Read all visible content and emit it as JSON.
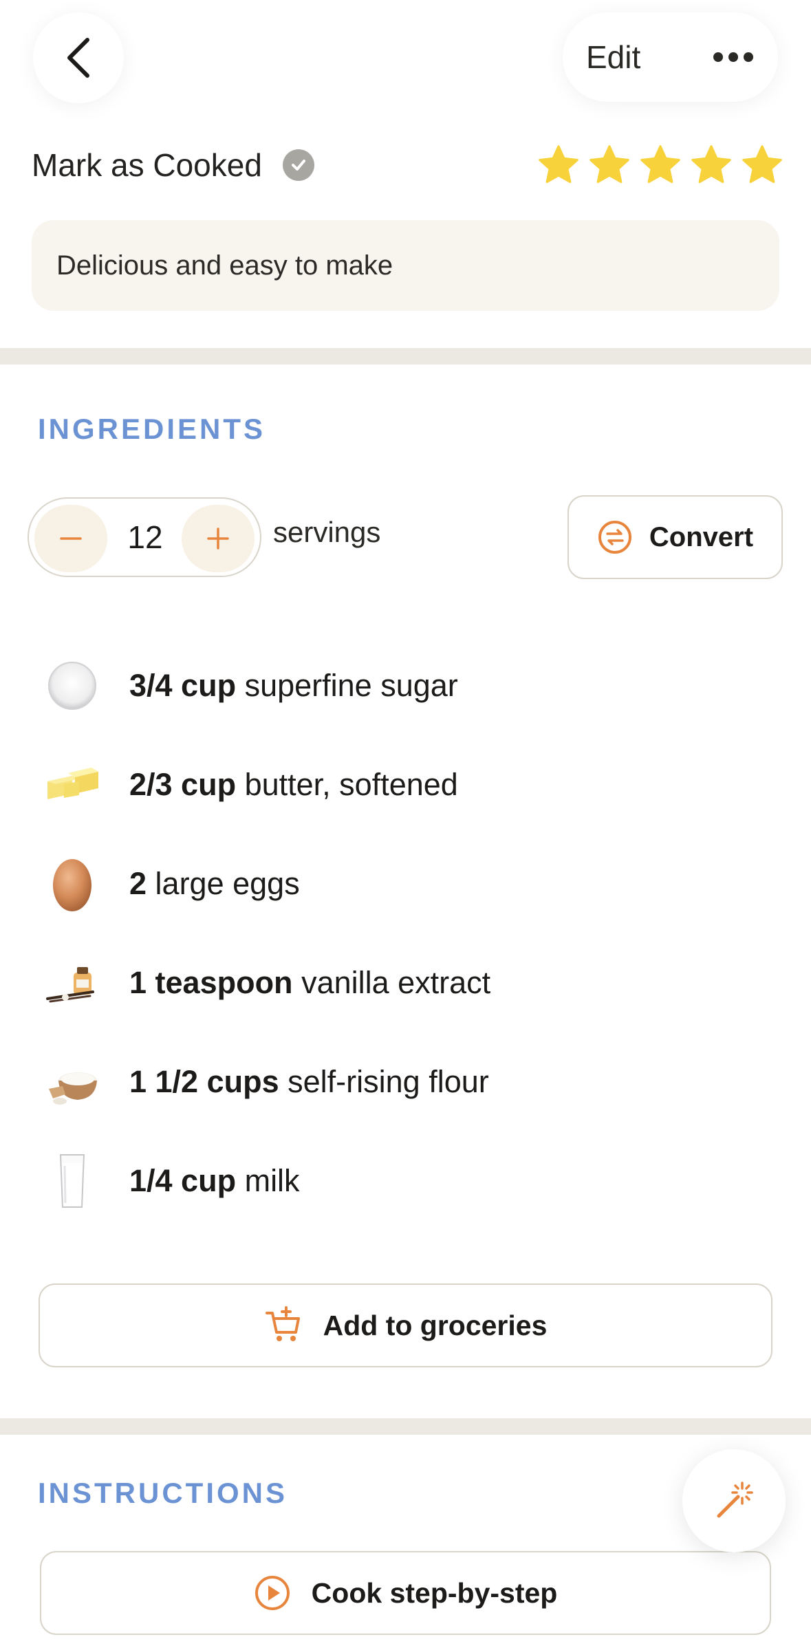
{
  "header": {
    "edit_label": "Edit"
  },
  "status": {
    "cooked_label": "Mark as Cooked",
    "rating": 5,
    "rating_max": 5
  },
  "note": "Delicious and easy to make",
  "ingredients_section": {
    "title": "INGREDIENTS",
    "servings_value": "12",
    "servings_label": "servings",
    "convert_label": "Convert",
    "items": [
      {
        "qty": "3/4 cup",
        "name": "superfine sugar",
        "icon": "sugar-icon"
      },
      {
        "qty": "2/3 cup",
        "name": "butter, softened",
        "icon": "butter-icon"
      },
      {
        "qty": "2",
        "name": "large eggs",
        "icon": "egg-icon"
      },
      {
        "qty": "1 teaspoon",
        "name": "vanilla extract",
        "icon": "vanilla-icon"
      },
      {
        "qty": "1 1/2 cups",
        "name": "self-rising flour",
        "icon": "flour-icon"
      },
      {
        "qty": "1/4 cup",
        "name": "milk",
        "icon": "milk-icon"
      }
    ],
    "groceries_label": "Add to groceries"
  },
  "instructions_section": {
    "title": "INSTRUCTIONS",
    "cook_label": "Cook step-by-step"
  },
  "colors": {
    "accent_orange": "#e8853d",
    "section_blue": "#6b93d4",
    "star_yellow": "#f7d23a"
  }
}
